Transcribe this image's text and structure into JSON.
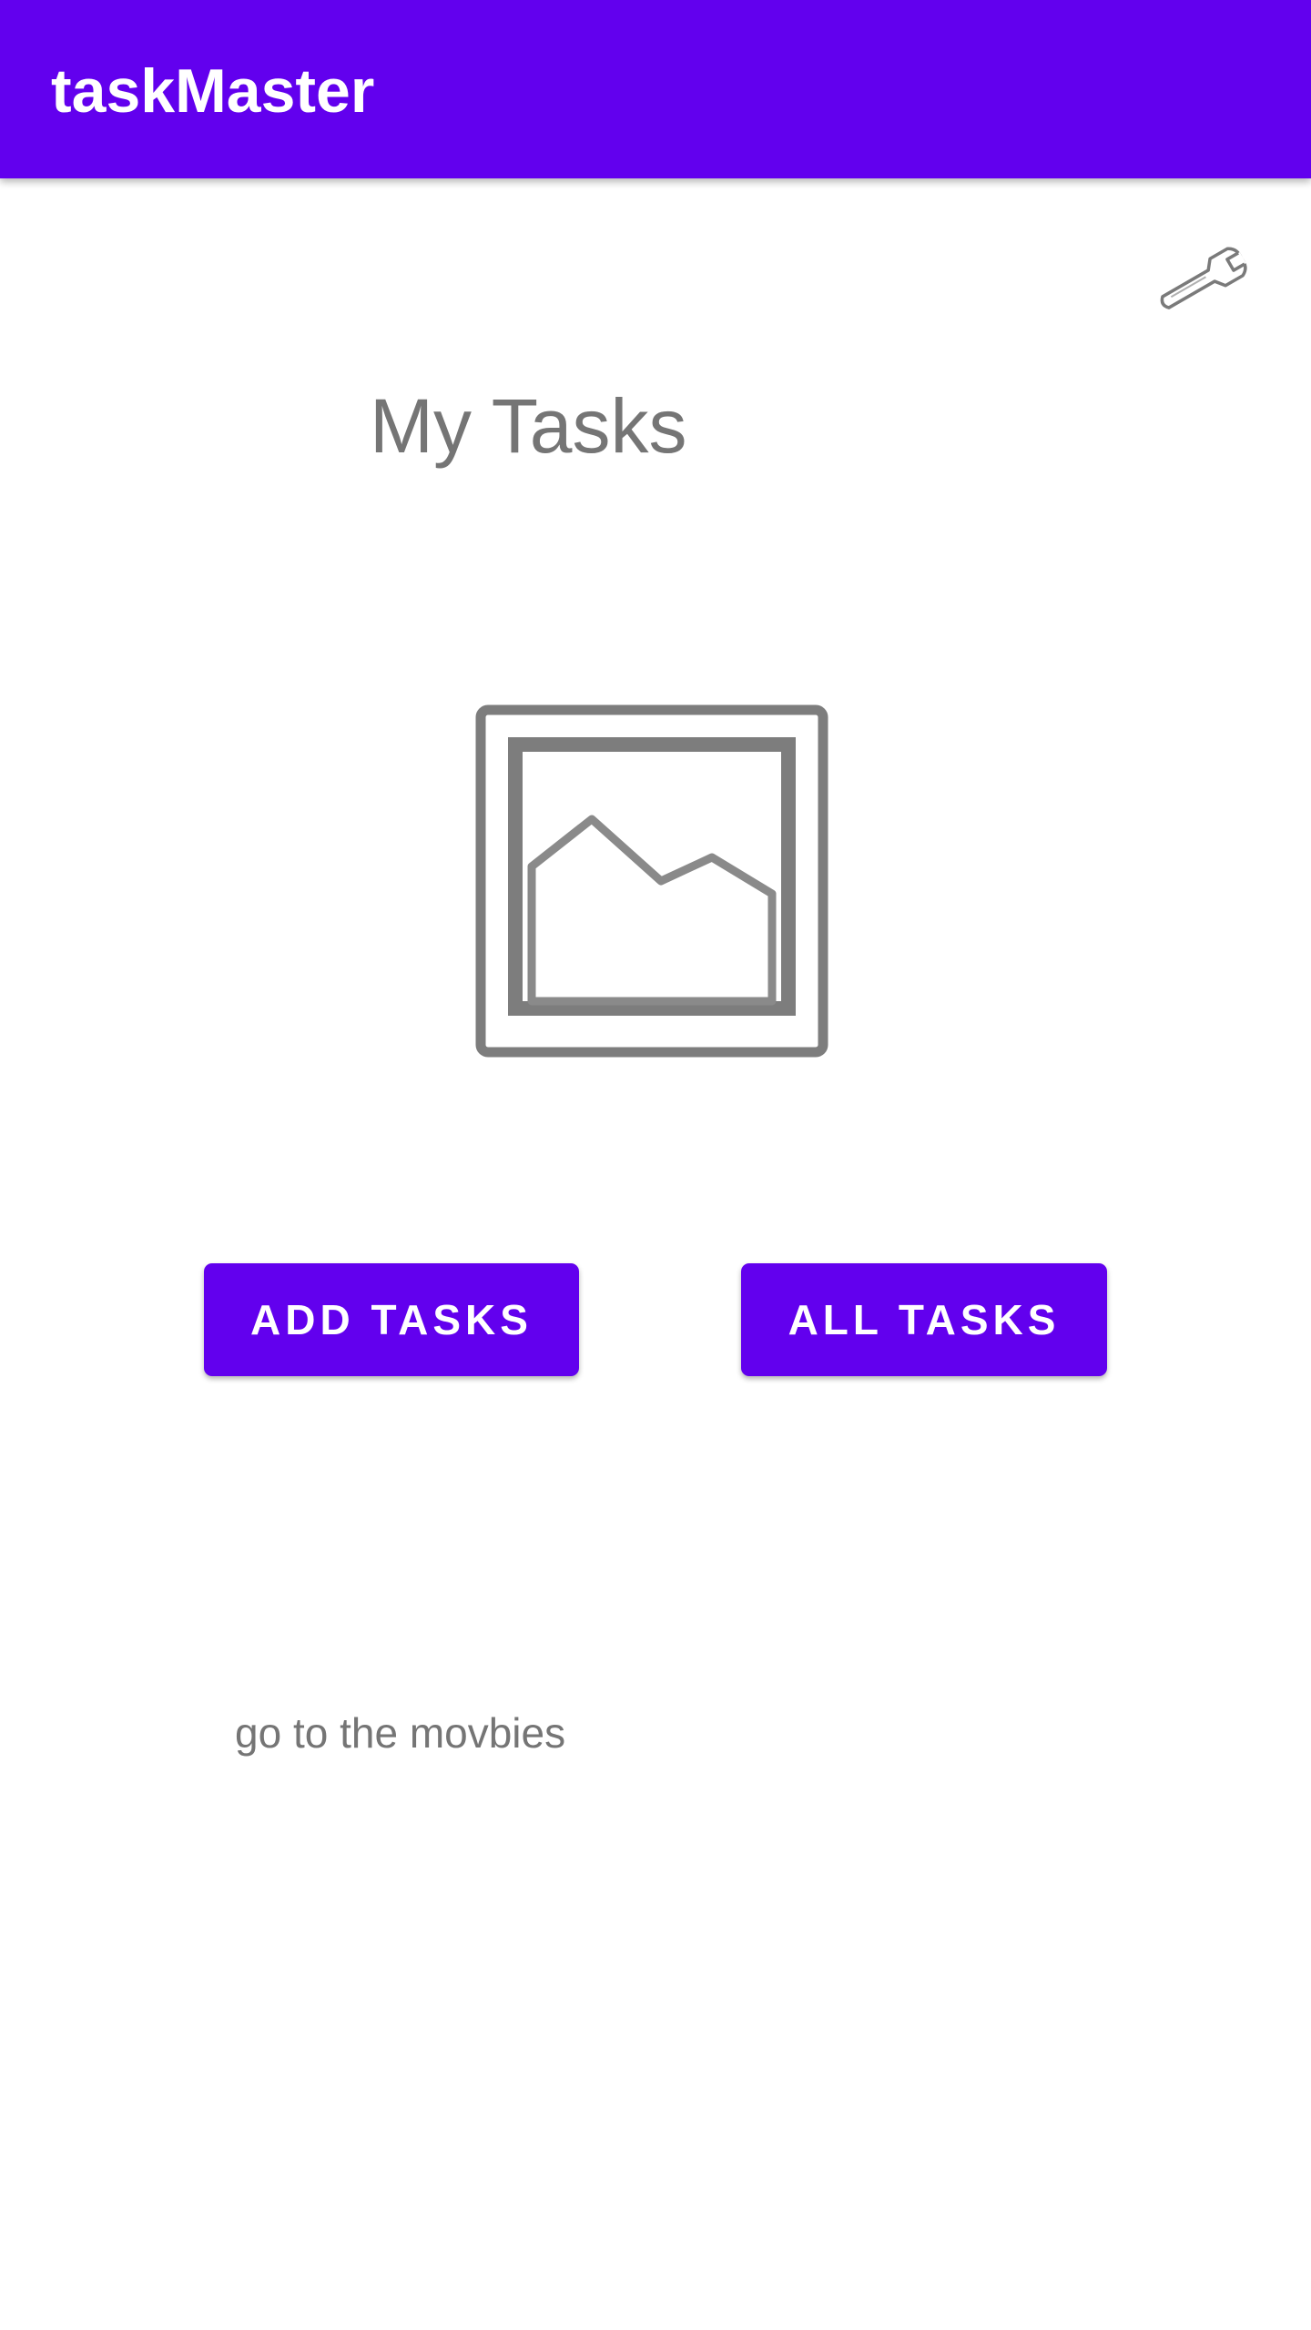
{
  "app_bar": {
    "title": "taskMaster",
    "background_color": "#6200ee"
  },
  "toolbar": {
    "settings_icon": "wrench-icon"
  },
  "main": {
    "title": "My Tasks",
    "image_icon": "image-placeholder-icon",
    "buttons": {
      "add_tasks": "ADD TASKS",
      "all_tasks": "ALL TASKS"
    },
    "task_text": "go to the movbies"
  },
  "colors": {
    "accent": "#6200ee",
    "text_secondary": "#757575",
    "background": "#ffffff"
  }
}
